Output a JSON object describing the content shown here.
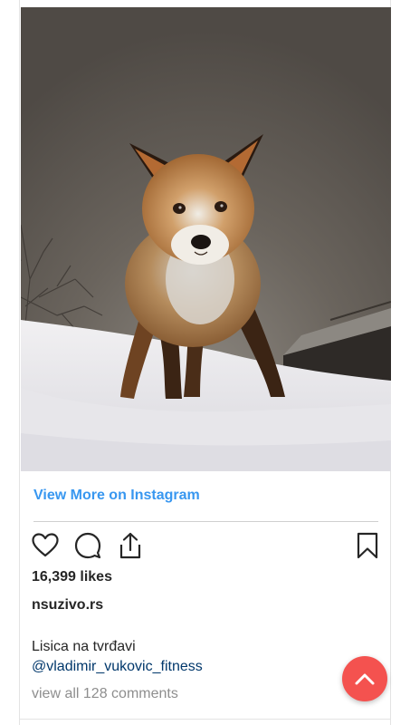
{
  "post": {
    "view_more_label": "View More on Instagram",
    "likes": "16,399 likes",
    "account": "nsuzivo.rs",
    "caption": "Lisica na tvrđavi",
    "mention": "@vladimir_vukovic_fitness",
    "view_comments": "view all 128 comments"
  },
  "icons": {
    "like": "heart-icon",
    "comment": "comment-icon",
    "share": "share-icon",
    "save": "bookmark-icon",
    "scroll_top": "chevron-up-icon"
  },
  "colors": {
    "link": "#3897f0",
    "mention": "#00376b",
    "muted": "#8e8e8e",
    "text": "#262626",
    "fab": "#f4524f"
  }
}
